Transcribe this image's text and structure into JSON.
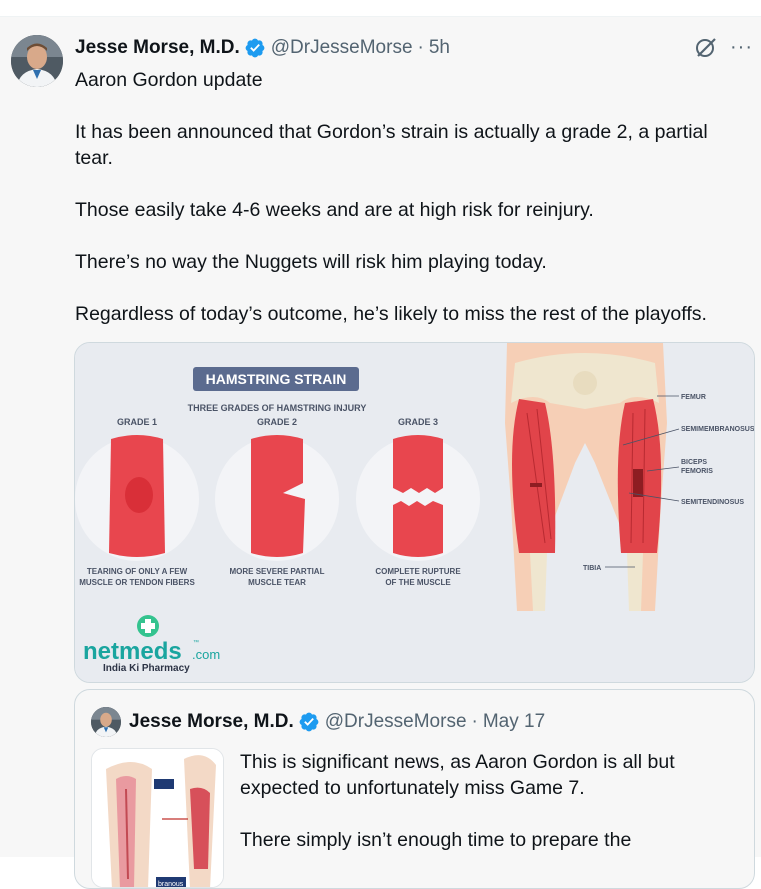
{
  "tweet": {
    "author_name": "Jesse Morse, M.D.",
    "handle": "@DrJesseMorse",
    "separator": "·",
    "time": "5h",
    "paragraphs": [
      "Aaron Gordon update",
      "It has been announced that Gordon’s strain is actually a grade 2, a partial tear.",
      "Those easily take 4-6 weeks and are at high risk for reinjury.",
      "There’s no way the Nuggets will risk him playing today.",
      "Regardless of today’s outcome, he’s likely to miss the rest of the playoffs."
    ],
    "more_label": "···"
  },
  "media": {
    "title": "HAMSTRING STRAIN",
    "subtitle": "THREE GRADES OF HAMSTRING INJURY",
    "grades": [
      {
        "label": "GRADE 1",
        "caption_1": "TEARING OF ONLY A FEW",
        "caption_2": "MUSCLE OR TENDON FIBERS"
      },
      {
        "label": "GRADE 2",
        "caption_1": "MORE SEVERE PARTIAL",
        "caption_2": "MUSCLE TEAR"
      },
      {
        "label": "GRADE 3",
        "caption_1": "COMPLETE RUPTURE",
        "caption_2": "OF THE MUSCLE"
      }
    ],
    "anatomy_labels": {
      "femur": "FEMUR",
      "semimembranosus": "SEMIMEMBRANOSUS",
      "biceps_1": "BICEPS",
      "biceps_2": "FEMORIS",
      "semitendinosus": "SEMITENDINOSUS",
      "tibia": "TIBIA"
    },
    "brand": "netmeds",
    "brand_suffix": ".com",
    "brand_tm": "™",
    "brand_tagline": "India Ki Pharmacy",
    "colors": {
      "muscle": "#e8464e",
      "muscle_light": "#f4a7a9",
      "brand_green": "#34c38f",
      "brand_teal": "#1aa59f",
      "title_badge": "#5b6b8f"
    }
  },
  "quote": {
    "author_name": "Jesse Morse, M.D.",
    "handle": "@DrJesseMorse",
    "separator": "·",
    "time": "May 17",
    "paragraphs": [
      "This is significant news, as Aaron Gordon is all but expected to unfortunately miss Game 7.",
      "There simply isn’t enough time to prepare the"
    ],
    "thumb_label": "branous"
  },
  "colors": {
    "verified": "#1d9bf0",
    "text_secondary": "#536471"
  }
}
